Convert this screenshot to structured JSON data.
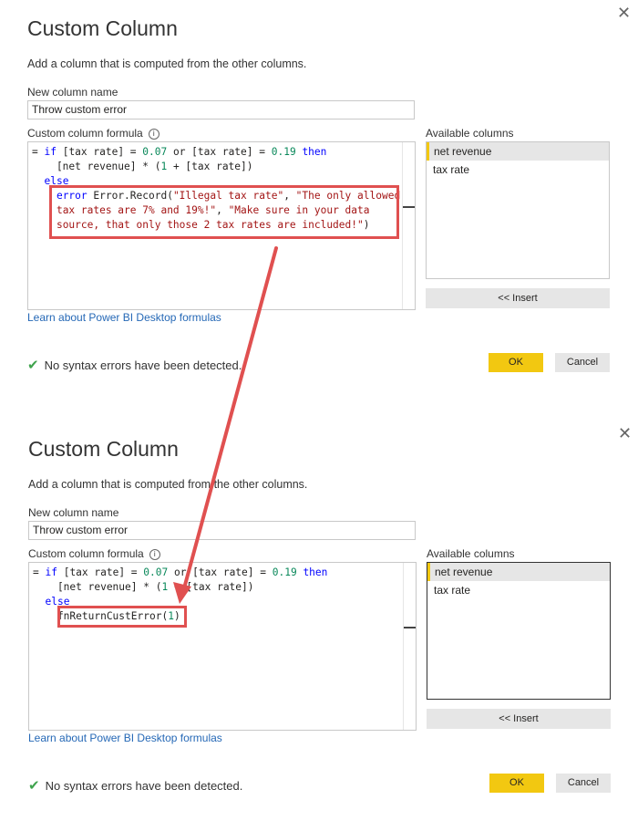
{
  "dialogs": [
    {
      "title": "Custom Column",
      "subtitle": "Add a column that is computed from the other columns.",
      "new_column_label": "New column name",
      "new_column_value": "Throw custom error",
      "formula_label": "Custom column formula",
      "formula_lines": [
        [
          [
            "p",
            "= "
          ],
          [
            "k",
            "if"
          ],
          [
            "p",
            " [tax rate] = "
          ],
          [
            "n",
            "0.07"
          ],
          [
            "p",
            " or [tax rate] = "
          ],
          [
            "n",
            "0.19"
          ],
          [
            "p",
            " "
          ],
          [
            "k",
            "then"
          ]
        ],
        [
          [
            "p",
            "    [net revenue] * ("
          ],
          [
            "n",
            "1"
          ],
          [
            "p",
            " + [tax rate])"
          ]
        ],
        [
          [
            "p",
            "  "
          ],
          [
            "k",
            "else"
          ]
        ],
        [
          [
            "p",
            "    "
          ],
          [
            "k",
            "error"
          ],
          [
            "p",
            " Error.Record("
          ],
          [
            "s",
            "\"Illegal tax rate\""
          ],
          [
            "p",
            ", "
          ],
          [
            "s",
            "\"The only allowed"
          ]
        ],
        [
          [
            "p",
            "    "
          ],
          [
            "s",
            "tax rates are 7% and 19%!\""
          ],
          [
            "p",
            ", "
          ],
          [
            "s",
            "\"Make sure in your data"
          ]
        ],
        [
          [
            "p",
            "    "
          ],
          [
            "s",
            "source, that only those 2 tax rates are included!\""
          ],
          [
            "p",
            ")"
          ]
        ]
      ],
      "available_label": "Available columns",
      "columns": [
        "net revenue",
        "tax rate"
      ],
      "insert_label": "<< Insert",
      "learn_link": "Learn about Power BI Desktop formulas",
      "status": "No syntax errors have been detected.",
      "ok_label": "OK",
      "cancel_label": "Cancel"
    },
    {
      "title": "Custom Column",
      "subtitle": "Add a column that is computed from the other columns.",
      "new_column_label": "New column name",
      "new_column_value": "Throw custom error",
      "formula_label": "Custom column formula",
      "formula_lines": [
        [
          [
            "p",
            "= "
          ],
          [
            "k",
            "if"
          ],
          [
            "p",
            " [tax rate] = "
          ],
          [
            "n",
            "0.07"
          ],
          [
            "p",
            " or [tax rate] = "
          ],
          [
            "n",
            "0.19"
          ],
          [
            "p",
            " "
          ],
          [
            "k",
            "then"
          ]
        ],
        [
          [
            "p",
            "    [net revenue] * ("
          ],
          [
            "n",
            "1"
          ],
          [
            "p",
            " + [tax rate])"
          ]
        ],
        [
          [
            "p",
            "  "
          ],
          [
            "k",
            "else"
          ]
        ],
        [
          [
            "p",
            "    fnReturnCustError("
          ],
          [
            "n",
            "1"
          ],
          [
            "p",
            ")"
          ]
        ]
      ],
      "available_label": "Available columns",
      "columns": [
        "net revenue",
        "tax rate"
      ],
      "insert_label": "<< Insert",
      "learn_link": "Learn about Power BI Desktop formulas",
      "status": "No syntax errors have been detected.",
      "ok_label": "OK",
      "cancel_label": "Cancel"
    }
  ],
  "annotation_color": "#e05050"
}
